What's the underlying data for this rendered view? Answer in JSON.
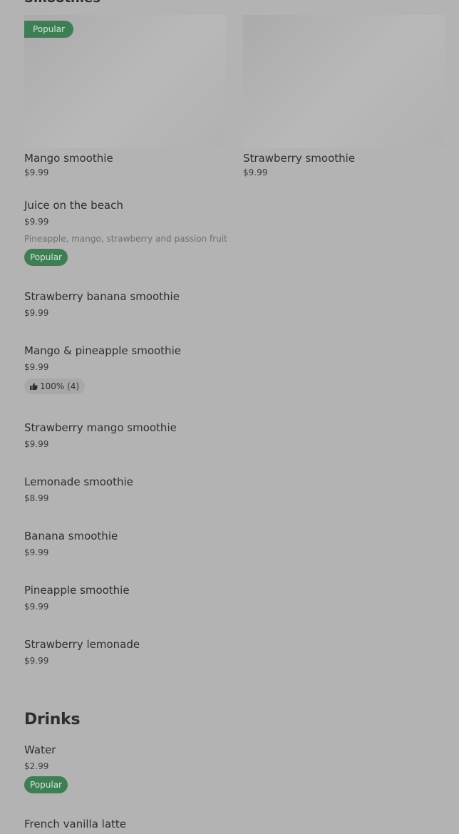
{
  "section_cut_title": "Smoothies",
  "featured": [
    {
      "name": "Mango smoothie",
      "price": "$9.99",
      "badge": "Popular"
    },
    {
      "name": "Strawberry smoothie",
      "price": "$9.99"
    }
  ],
  "items": [
    {
      "name": "Juice on the beach",
      "price": "$9.99",
      "description": "Pineapple, mango, strawberry and passion fruit",
      "badge": "Popular"
    },
    {
      "name": "Strawberry banana smoothie",
      "price": "$9.99"
    },
    {
      "name": "Mango & pineapple smoothie",
      "price": "$9.99",
      "rating": "100% (4)"
    },
    {
      "name": "Strawberry mango smoothie",
      "price": "$9.99"
    },
    {
      "name": "Lemonade smoothie",
      "price": "$8.99"
    },
    {
      "name": "Banana smoothie",
      "price": "$9.99"
    },
    {
      "name": "Pineapple smoothie",
      "price": "$9.99"
    },
    {
      "name": "Strawberry lemonade",
      "price": "$9.99"
    }
  ],
  "drinks": {
    "title": "Drinks",
    "items": [
      {
        "name": "Water",
        "price": "$2.99",
        "badge": "Popular"
      },
      {
        "name": "French vanilla latte"
      }
    ]
  },
  "icons": {
    "rating": "thumbs-up-icon"
  },
  "colors": {
    "popular_badge": "#3f7e55",
    "overlay_bg": "#b3b3b3"
  }
}
